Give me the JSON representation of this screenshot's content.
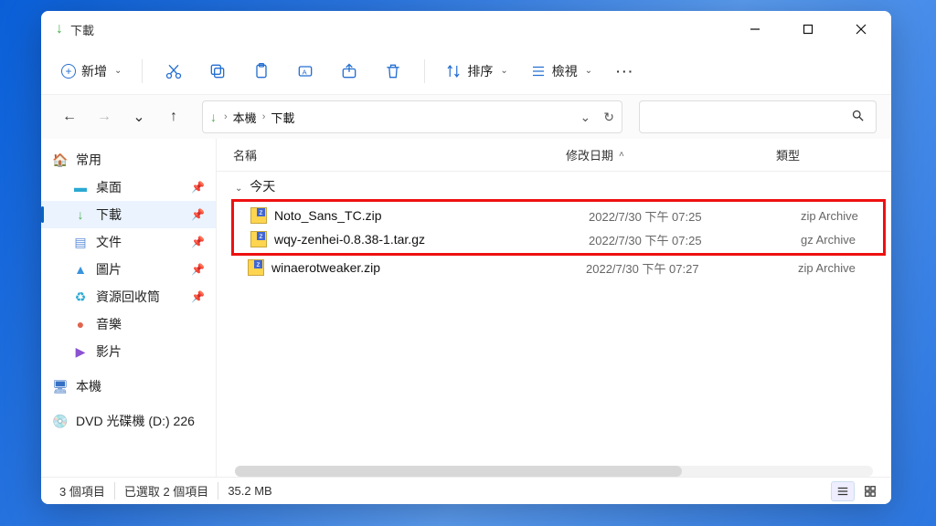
{
  "title": "下載",
  "toolbar": {
    "new_label": "新增",
    "sort_label": "排序",
    "view_label": "檢視"
  },
  "breadcrumb": {
    "items": [
      "本機",
      "下載"
    ]
  },
  "sidebar": {
    "quick_access": "常用",
    "items": [
      {
        "label": "桌面"
      },
      {
        "label": "下載"
      },
      {
        "label": "文件"
      },
      {
        "label": "圖片"
      },
      {
        "label": "資源回收筒"
      },
      {
        "label": "音樂"
      },
      {
        "label": "影片"
      }
    ],
    "this_pc": "本機",
    "dvd": "DVD 光碟機 (D:) 226"
  },
  "columns": {
    "name": "名稱",
    "date": "修改日期",
    "type": "類型"
  },
  "group_label": "今天",
  "files": [
    {
      "name": "Noto_Sans_TC.zip",
      "date": "2022/7/30 下午 07:25",
      "type": "zip Archive"
    },
    {
      "name": "wqy-zenhei-0.8.38-1.tar.gz",
      "date": "2022/7/30 下午 07:25",
      "type": "gz Archive"
    },
    {
      "name": "winaerotweaker.zip",
      "date": "2022/7/30 下午 07:27",
      "type": "zip Archive"
    }
  ],
  "status": {
    "item_count": "3 個項目",
    "selection": "已選取 2 個項目",
    "size": "35.2 MB"
  }
}
